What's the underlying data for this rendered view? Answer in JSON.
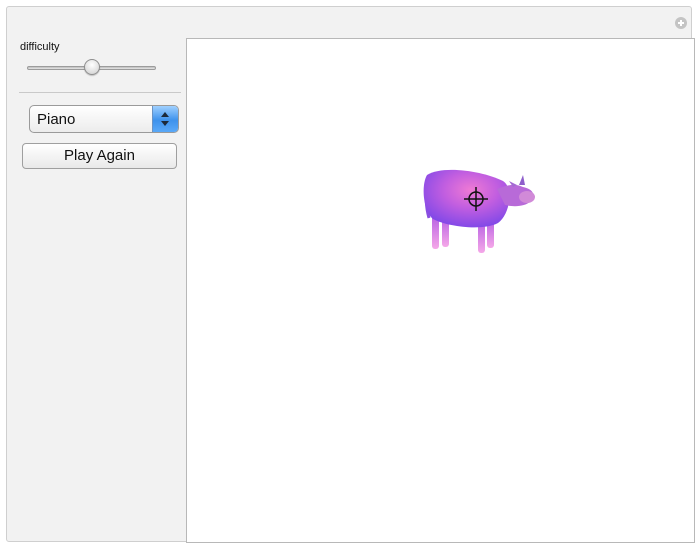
{
  "controls": {
    "difficulty_label": "difficulty",
    "difficulty_value": 0.5,
    "instrument_selected": "Piano",
    "play_again_label": "Play Again"
  },
  "icons": {
    "add": "plus-icon",
    "select_arrows": "up-down-arrows-icon",
    "target": "crosshair-icon"
  },
  "colors": {
    "select_accent": "#3e92ec",
    "cow_primary": "#9a55e6",
    "cow_highlight": "#e774d2"
  }
}
